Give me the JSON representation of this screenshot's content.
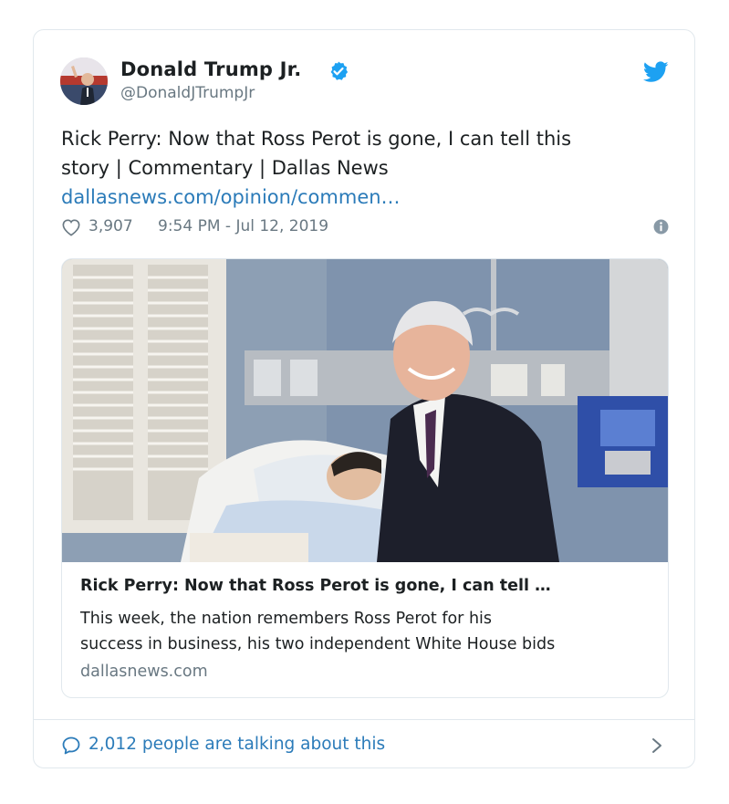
{
  "tweet": {
    "author_name": "Donald Trump Jr.",
    "handle": "@DonaldJTrumpJr",
    "text_lines": [
      "Rick Perry: Now that Ross Perot is gone, I can tell this",
      "story | Commentary | Dallas News"
    ],
    "link_text": "dallasnews.com/opinion/commen…",
    "likes": "3,907",
    "timestamp": "9:54 PM - Jul 12, 2019"
  },
  "link_card": {
    "title": "Rick Perry: Now that Ross Perot is gone, I can tell …",
    "description_lines": [
      "This week, the nation remembers Ross Perot for his",
      "success in business, his two independent White House bids"
    ],
    "domain": "dallasnews.com"
  },
  "footer": {
    "talking_text": "2,012 people are talking about this"
  },
  "icons": {
    "verified": "verified-badge-icon",
    "twitter": "twitter-bird-icon",
    "like": "heart-icon",
    "info": "info-icon",
    "reply": "speech-bubble-icon",
    "chevron": "chevron-right-icon"
  },
  "colors": {
    "accent": "#1da1f2",
    "link": "#2b7bb9",
    "muted": "#697882",
    "text": "#1c2022",
    "border": "#e1e8ed"
  }
}
